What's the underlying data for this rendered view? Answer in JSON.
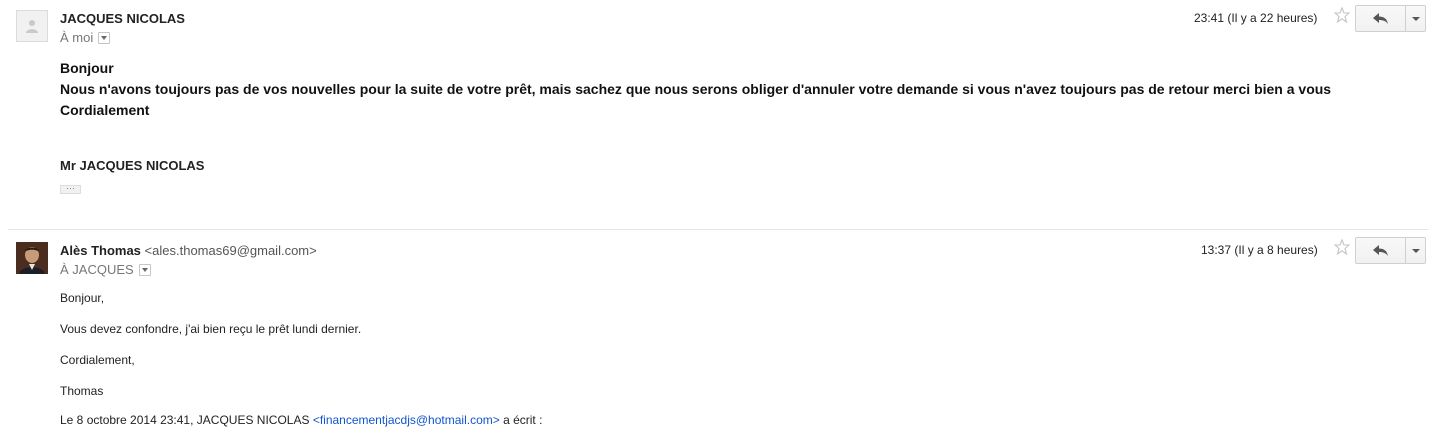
{
  "messages": [
    {
      "sender_name": "JACQUES NICOLAS",
      "recipient": "À moi",
      "time": "23:41 (Il y a 22 heures)",
      "body_lines": [
        "Bonjour",
        "Nous n'avons toujours pas de vos nouvelles pour la suite de votre prêt, mais sachez que nous serons obliger d'annuler votre demande si vous n'avez toujours pas de retour merci bien a vous",
        "Cordialement"
      ],
      "signature": "Mr JACQUES NICOLAS",
      "ellipsis": "···"
    },
    {
      "sender_name": "Alès Thomas",
      "sender_email": "<ales.thomas69@gmail.com>",
      "recipient": "À JACQUES",
      "time": "13:37 (Il y a 8 heures)",
      "body_lines": [
        "Bonjour,",
        "Vous devez confondre, j'ai bien reçu le prêt lundi dernier.",
        "Cordialement,",
        "Thomas"
      ],
      "quote_prefix": "Le 8 octobre 2014 23:41, JACQUES NICOLAS ",
      "quote_email": "<financementjacdjs@hotmail.com>",
      "quote_suffix": " a écrit :"
    }
  ],
  "icons": {
    "avatar_default": "person-silhouette-icon",
    "star": "star-outline-icon",
    "reply": "reply-arrow-icon",
    "more": "chevron-down-icon"
  },
  "colors": {
    "link": "#1155cc",
    "divider": "#e5e5e5",
    "muted_text": "#777777"
  }
}
